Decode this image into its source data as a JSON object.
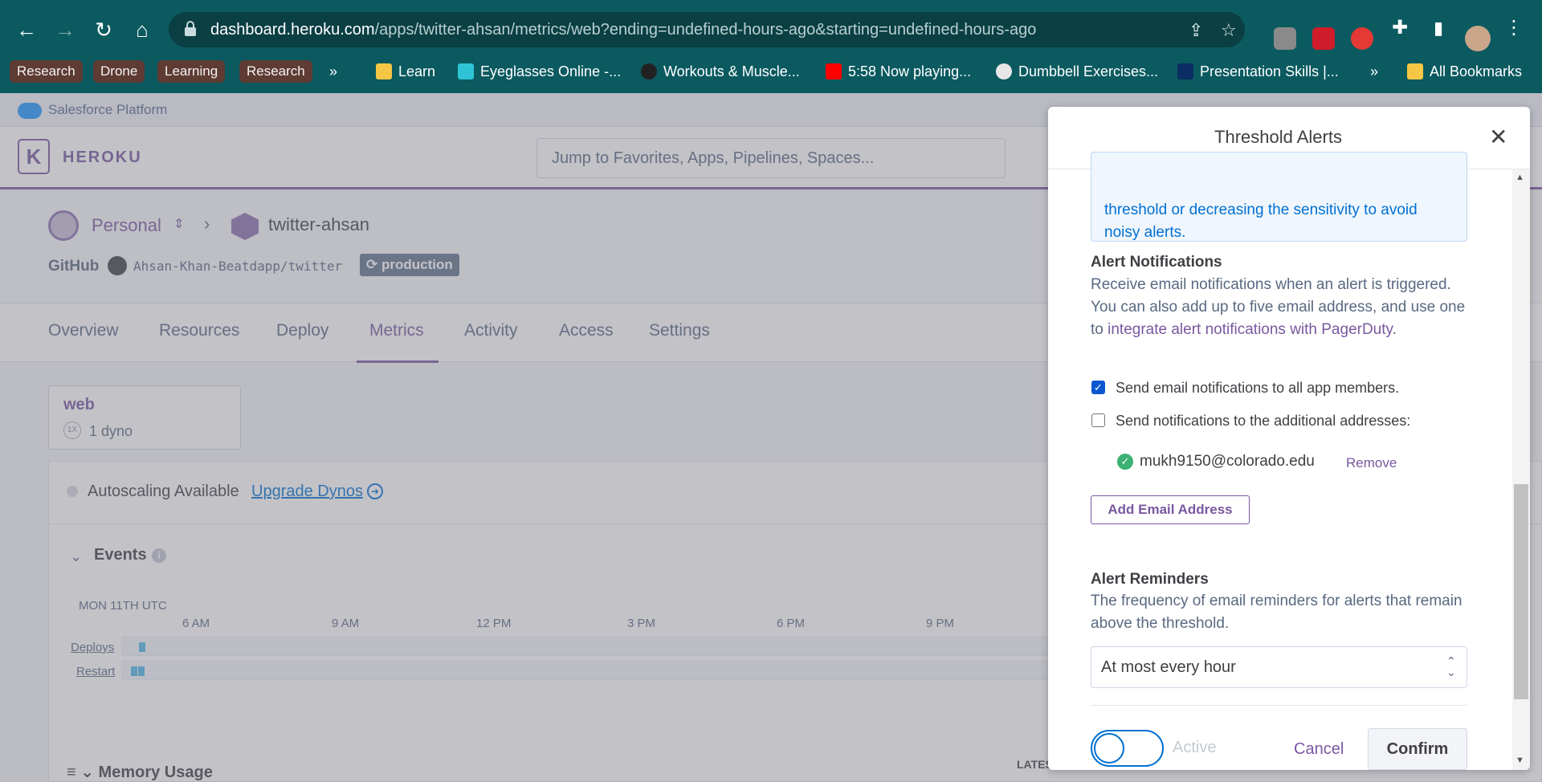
{
  "browser": {
    "url_host": "dashboard.heroku.com",
    "url_path": "/apps/twitter-ahsan/metrics/web?ending=undefined-hours-ago&starting=undefined-hours-ago",
    "bookmark_chips": [
      "Research",
      "Drone",
      "Learning",
      "Research"
    ],
    "bookmarks_more": "»",
    "bookmarks": [
      "Learn",
      "Eyeglasses Online -...",
      "Workouts & Muscle...",
      "5:58 Now playing...",
      "Dumbbell Exercises...",
      "Presentation Skills |..."
    ],
    "bookmarks_more_right": "»",
    "all_bookmarks": "All Bookmarks"
  },
  "platform_bar": {
    "label": "Salesforce Platform"
  },
  "heroku": {
    "logo_letter": "K",
    "brand": "HEROKU",
    "search_placeholder": "Jump to Favorites, Apps, Pipelines, Spaces..."
  },
  "app_header": {
    "workspace": "Personal",
    "app_name": "twitter-ahsan",
    "github_label": "GitHub",
    "repo": "Ahsan-Khan-Beatdapp/twitter",
    "badge": "production"
  },
  "tabs": [
    "Overview",
    "Resources",
    "Deploy",
    "Metrics",
    "Activity",
    "Access",
    "Settings"
  ],
  "dyno_card": {
    "title": "web",
    "size": "1X",
    "count": "1 dyno"
  },
  "metrics": {
    "autoscaling_text": "Autoscaling Available",
    "upgrade_link": "Upgrade Dynos",
    "events_title": "Events",
    "date_label": "MON 11TH UTC",
    "ticks": [
      "6 AM",
      "9 AM",
      "12 PM",
      "3 PM",
      "6 PM",
      "9 PM"
    ],
    "track_labels": [
      "Deploys",
      "Restart"
    ],
    "memory_title": "Memory Usage",
    "latest_label": "LATEST"
  },
  "modal": {
    "title": "Threshold Alerts",
    "info_text": "threshold or decreasing the sensitivity to avoid noisy alerts.",
    "notifications_title": "Alert Notifications",
    "notifications_desc": "Receive email notifications when an alert is triggered. You can also add up to five email address, and use one to ",
    "notifications_link": "integrate alert notifications with PagerDuty",
    "notifications_period": ".",
    "checkbox_all_members": "Send email notifications to all app members.",
    "checkbox_all_members_checked": true,
    "checkbox_additional": "Send notifications to the additional addresses:",
    "checkbox_additional_checked": false,
    "email": "mukh9150@colorado.edu",
    "remove_label": "Remove",
    "add_email_label": "Add Email Address",
    "reminders_title": "Alert Reminders",
    "reminders_desc": "The frequency of email reminders for alerts that remain above the threshold.",
    "reminder_selected": "At most every hour",
    "toggle_label": "Active",
    "cancel_label": "Cancel",
    "confirm_label": "Confirm"
  }
}
